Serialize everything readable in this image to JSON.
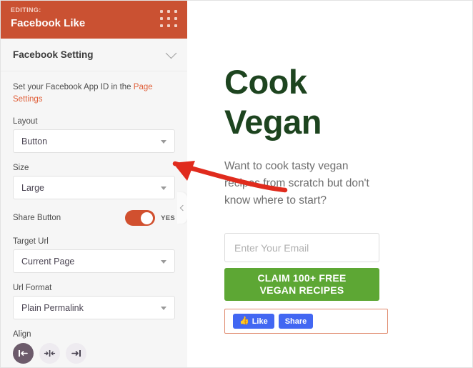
{
  "sidebar": {
    "header": {
      "editing_label": "EDITING:",
      "title": "Facebook Like",
      "drag_handle_icon": "grid-dots-icon"
    },
    "panel": {
      "title": "Facebook Setting",
      "collapse_icon": "chevron-down-icon"
    },
    "help": {
      "text_before": "Set your Facebook App ID in the ",
      "link": "Page Settings"
    },
    "fields": [
      {
        "label": "Layout",
        "value": "Button",
        "icon": "caret-down-icon"
      },
      {
        "label": "Size",
        "value": "Large",
        "icon": "caret-down-icon"
      },
      {
        "label": "Target Url",
        "value": "Current Page",
        "icon": "caret-down-icon"
      },
      {
        "label": "Url Format",
        "value": "Plain Permalink",
        "icon": "caret-down-icon"
      }
    ],
    "share_button": {
      "label": "Share Button",
      "state": "YES"
    },
    "align": {
      "label": "Align",
      "options": [
        {
          "name": "align-left",
          "glyph": "|←",
          "active": true
        },
        {
          "name": "align-center",
          "glyph": "→|←",
          "active": false
        },
        {
          "name": "align-right",
          "glyph": "→|",
          "active": false
        }
      ]
    },
    "collapse_handle_icon": "chevron-left-icon"
  },
  "preview": {
    "headline": "Cook Vegan",
    "subheadline": "Want to cook tasty vegan recipes from scratch but don't know where to start?",
    "email_placeholder": "Enter Your Email",
    "cta_line1": "CLAIM 100+ FREE",
    "cta_line2": "VEGAN RECIPES",
    "facebook": {
      "like_label": "Like",
      "share_label": "Share",
      "thumb_icon": "thumbs-up-icon"
    }
  },
  "annotation": {
    "arrow_name": "red-pointer-arrow",
    "color": "#e02b1d"
  },
  "colors": {
    "brand_orange": "#ca5132",
    "link_orange": "#e0603a",
    "headline_green": "#1d441f",
    "cta_green": "#5da734",
    "facebook_blue": "#4267f2",
    "align_active": "#6c5b6b",
    "sidebar_bg": "#f6f6f6"
  }
}
